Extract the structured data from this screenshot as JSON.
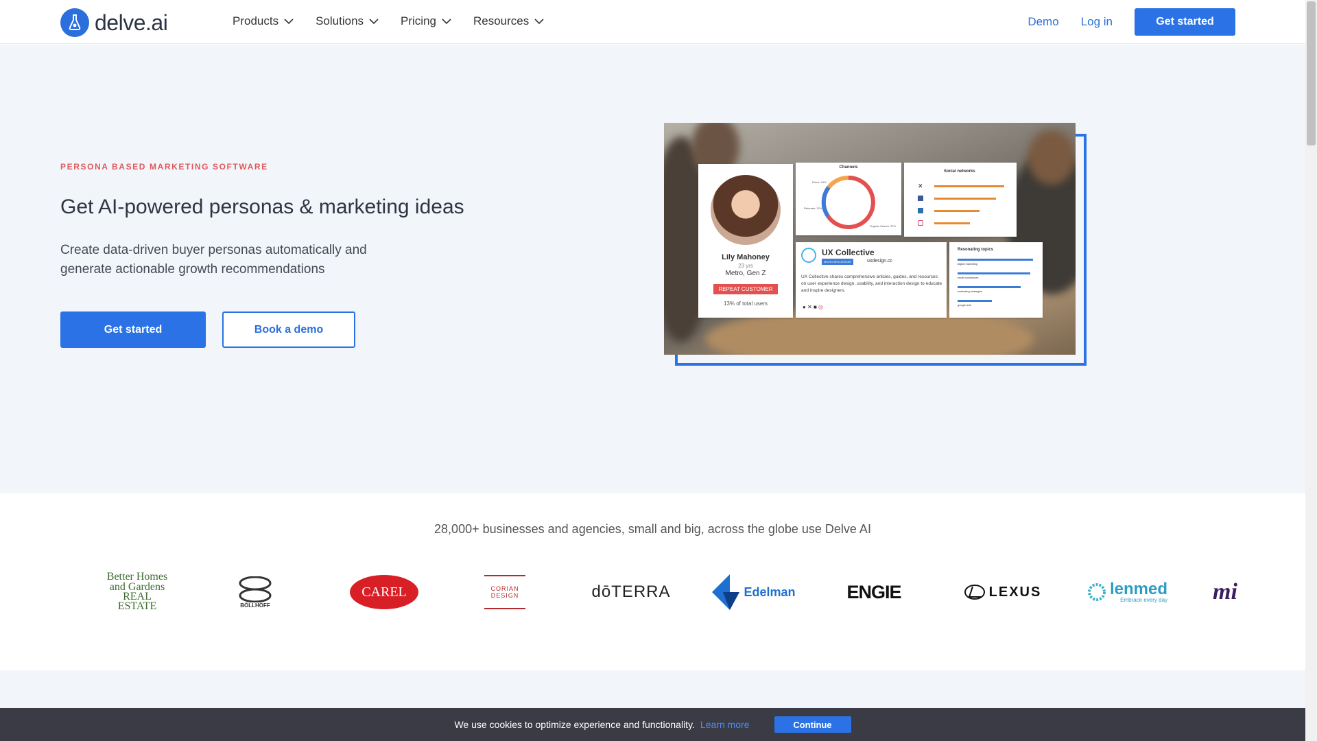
{
  "header": {
    "logo_text": "delve.ai",
    "nav": [
      {
        "label": "Products"
      },
      {
        "label": "Solutions"
      },
      {
        "label": "Pricing"
      },
      {
        "label": "Resources"
      }
    ],
    "demo_label": "Demo",
    "login_label": "Log in",
    "cta_label": "Get started"
  },
  "hero": {
    "eyebrow": "PERSONA BASED MARKETING SOFTWARE",
    "title": "Get AI-powered personas & marketing ideas",
    "lede": "Create data-driven buyer personas automatically and generate actionable growth recommendations",
    "primary_cta": "Get started",
    "secondary_cta": "Book a demo",
    "persona_card": {
      "name": "Lily Mahoney",
      "age": "23 yrs",
      "segment": "Metro, Gen Z",
      "badge": "REPEAT CUSTOMER",
      "share": "13% of total users"
    },
    "channels_card": {
      "title": "Channels",
      "labels": [
        "Direct: 34%",
        "Referrals: 22%",
        "Organic Search: 37%"
      ]
    },
    "social_card": {
      "title": "Social networks"
    },
    "influencer_card": {
      "name": "UX Collective",
      "tag": "MICRO INFLUENCER",
      "site": "uxdesign.cc",
      "desc": "UX Collective shares comprehensive articles, guides, and resources on user experience design, usability, and interaction design to educate and inspire designers."
    },
    "topics_card": {
      "title": "Resonating topics",
      "topics": [
        "digital marketing",
        "small businesses",
        "marketing strategies",
        "google ads"
      ]
    }
  },
  "logos": {
    "title": "28,000+ businesses and agencies, small and big, across the globe use Delve AI",
    "brands": [
      "Better Homes and Gardens REAL ESTATE",
      "BÖLLHOFF",
      "CAREL",
      "CORIAN DESIGN",
      "dōTERRA",
      "Edelman",
      "ENGIE",
      "LEXUS",
      "lenmed",
      "Embrace every day",
      "mi"
    ]
  },
  "cookie": {
    "text": "We use cookies to optimize experience and functionality.",
    "link": "Learn more",
    "button": "Continue"
  },
  "colors": {
    "primary": "#2a72e5",
    "accent": "#e0585a",
    "hero_bg": "#f2f6fb",
    "cookie_bg": "#3b3b46"
  }
}
